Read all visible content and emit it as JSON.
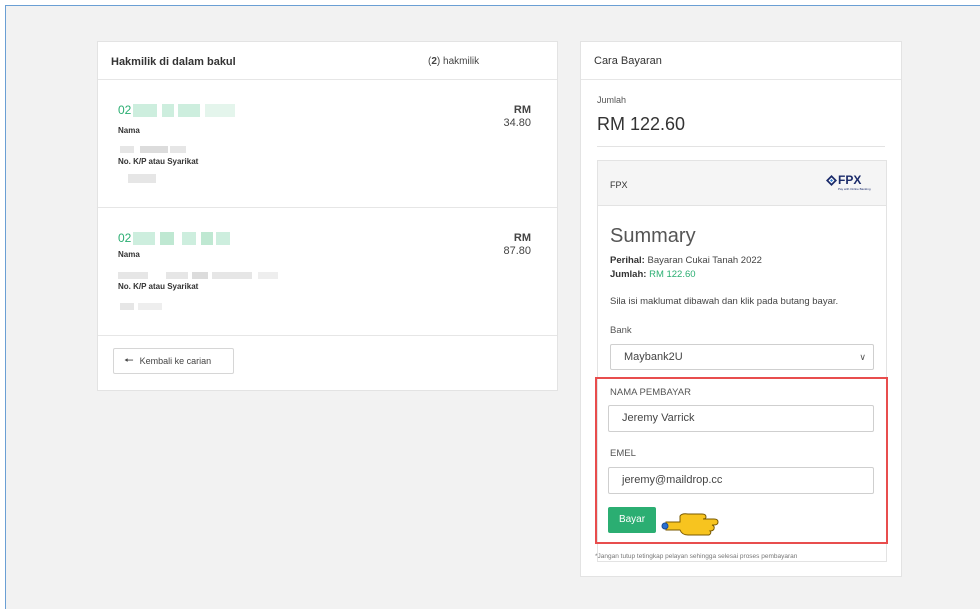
{
  "basket": {
    "title": "Hakmilik di dalam bakul",
    "count": "2",
    "count_suffix": " hakmilik",
    "items": [
      {
        "id_prefix": "02",
        "currency": "RM",
        "amount": "34.80",
        "nama_label": "Nama",
        "nokp_label": "No. K/P atau Syarikat"
      },
      {
        "id_prefix": "02",
        "currency": "RM",
        "amount": "87.80",
        "nama_label": "Nama",
        "nokp_label": "No. K/P atau Syarikat"
      }
    ],
    "back_label": "Kembali ke carian"
  },
  "payment": {
    "title": "Cara Bayaran",
    "jumlah_label": "Jumlah",
    "jumlah_value": "RM 122.60",
    "method": "FPX",
    "fpx_logo_text": "FPX",
    "fpx_logo_sub": "Pay with Online Banking",
    "summary": {
      "title": "Summary",
      "perihal_label": "Perihal:",
      "perihal_value": "Bayaran Cukai Tanah 2022",
      "jumlah_label": "Jumlah:",
      "jumlah_value": "RM 122.60",
      "instruction": "Sila isi maklumat dibawah dan klik pada butang bayar."
    },
    "bank_label": "Bank",
    "bank_selected": "Maybank2U",
    "payer_label": "NAMA PEMBAYAR",
    "payer_value": "Jeremy Varrick",
    "email_label": "EMEL",
    "email_value": "jeremy@maildrop.cc",
    "pay_button": "Bayar",
    "note": "*Jangan tutup tetingkap pelayan sehingga selesai proses pembayaran"
  },
  "colors": {
    "accent_green": "#2bae72",
    "highlight_red": "#e84d4d",
    "frame_blue": "#6a9fd4"
  }
}
